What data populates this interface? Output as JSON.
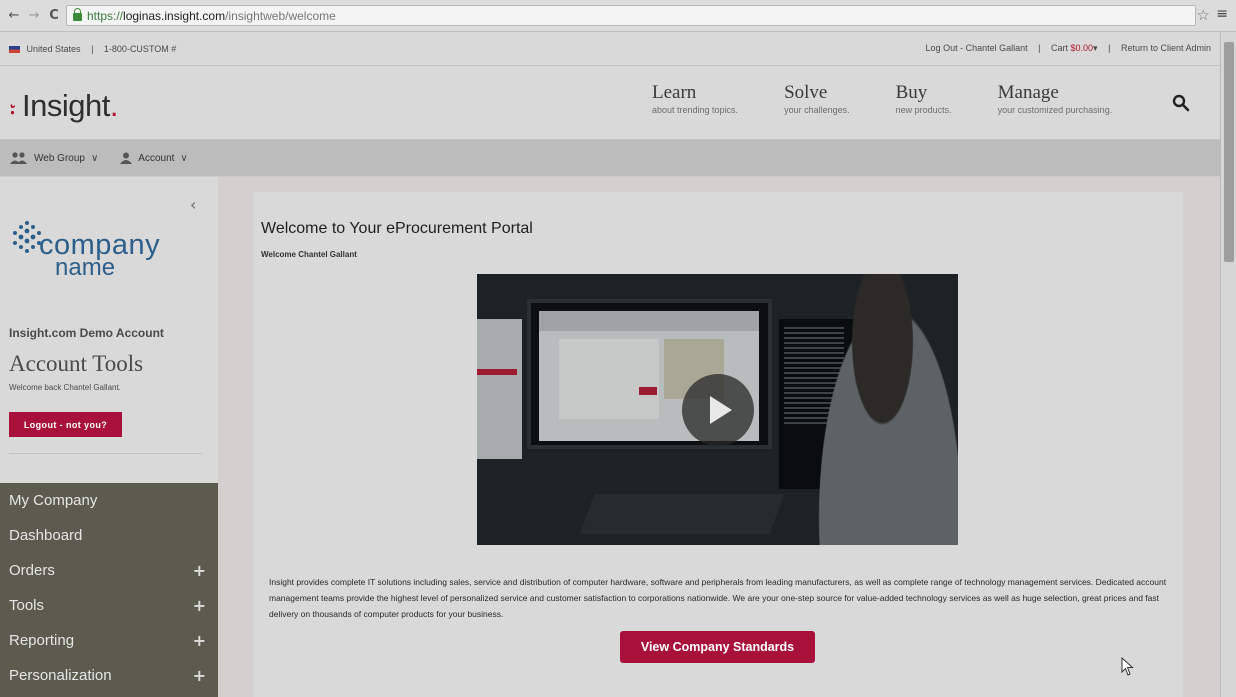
{
  "browser": {
    "url_proto": "https://",
    "url_host": "loginas.insight.com",
    "url_path": "/insightweb/welcome",
    "back_icon": "←",
    "forward_icon": "→",
    "reload_icon": "C",
    "star_icon": "☆",
    "menu_icon": "≡"
  },
  "utility": {
    "country": "United States",
    "phone": "1-800-CUSTOM #",
    "logout": "Log Out - Chantel Gallant",
    "cart_label": "Cart",
    "cart_amount": "$0.00",
    "return": "Return to Client Admin"
  },
  "header": {
    "logo_mark": "⹎",
    "logo_text": "Insight",
    "logo_dot": ".",
    "nav": [
      {
        "title": "Learn",
        "sub": "about trending topics."
      },
      {
        "title": "Solve",
        "sub": "your challenges."
      },
      {
        "title": "Buy",
        "sub": "new products."
      },
      {
        "title": "Manage",
        "sub": "your customized purchasing."
      }
    ]
  },
  "groupbar": {
    "web_group": "Web Group",
    "account": "Account",
    "chevron": "∨"
  },
  "sidebar": {
    "collapse_icon": "‹",
    "company_word": "company",
    "name_word": "name",
    "demo_account": "Insight.com Demo Account",
    "account_tools": "Account Tools",
    "welcome_back": "Welcome back Chantel Gallant.",
    "logout_button": "Logout - not you?",
    "menu": [
      {
        "label": "My Company",
        "plus": ""
      },
      {
        "label": "Dashboard",
        "plus": ""
      },
      {
        "label": "Orders",
        "plus": "+"
      },
      {
        "label": "Tools",
        "plus": "+"
      },
      {
        "label": "Reporting",
        "plus": "+"
      },
      {
        "label": "Personalization",
        "plus": "+"
      }
    ]
  },
  "main": {
    "title": "Welcome to Your eProcurement Portal",
    "welcome": "Welcome Chantel Gallant",
    "description": "Insight provides complete IT solutions including sales, service and distribution of computer hardware, software and peripherals from leading manufacturers, as well as complete range of technology management services. Dedicated account management teams provide the highest level of personalized service and customer satisfaction to corporations nationwide. We are your one-step source for value-added technology services as well as huge selection, great prices and fast delivery on thousands of computer products for your business.",
    "standards_button": "View Company Standards"
  },
  "colors": {
    "brand_red": "#a8123a",
    "sidebar_menu_bg": "#5c5b4f"
  }
}
